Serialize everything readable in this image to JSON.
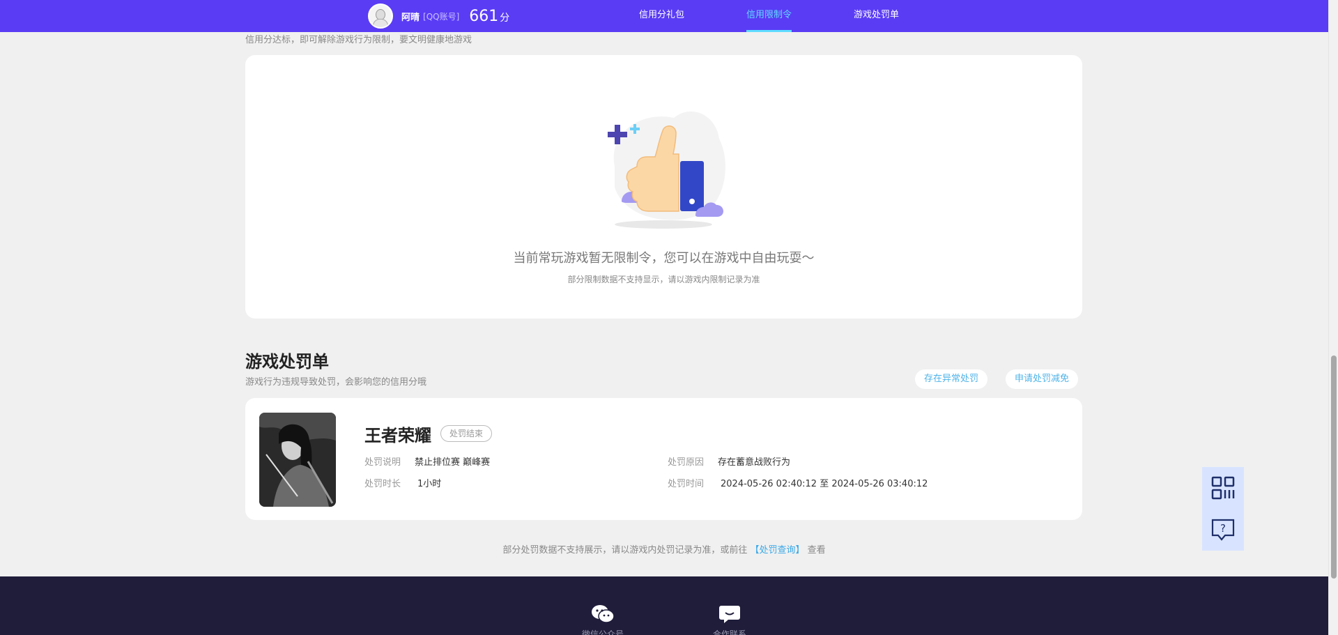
{
  "header": {
    "user_name": "阿晴",
    "account_type": "[QQ账号]",
    "score": "661",
    "score_unit": "分",
    "nav": [
      {
        "label": "信用分礼包",
        "active": false
      },
      {
        "label": "信用限制令",
        "active": true
      },
      {
        "label": "游戏处罚单",
        "active": false
      }
    ]
  },
  "restriction": {
    "tip": "信用分达标，即可解除游戏行为限制，要文明健康地游戏",
    "empty_message": "当前常玩游戏暂无限制令，您可以在游戏中自由玩耍～",
    "empty_sub": "部分限制数据不支持显示，请以游戏内限制记录为准"
  },
  "penalty": {
    "title": "游戏处罚单",
    "subtitle": "游戏行为违规导致处罚，会影响您的信用分哦",
    "btn_abnormal": "存在异常处罚",
    "btn_reduce": "申请处罚减免",
    "item": {
      "game": "王者荣耀",
      "status": "处罚结束",
      "desc_label": "处罚说明",
      "desc_value": "禁止排位赛 巅峰赛",
      "duration_label": "处罚时长",
      "duration_value": "1小时",
      "reason_label": "处罚原因",
      "reason_value": "存在蓄意战败行为",
      "time_label": "处罚时间",
      "time_value": "2024-05-26 02:40:12 至 2024-05-26 03:40:12"
    },
    "bottom_tip_prefix": "部分处罚数据不支持展示，请以游戏内处罚记录为准，或前往",
    "bottom_tip_link": "【处罚查询】",
    "bottom_tip_suffix": "查看"
  },
  "footer": {
    "items": [
      {
        "label": "微信公众号",
        "icon": "wechat-icon"
      },
      {
        "label": "合作联系",
        "icon": "chat-icon"
      }
    ]
  },
  "colors": {
    "topbar": "#5a3cf5",
    "active_nav": "#5fdcff",
    "link": "#38a8e8",
    "footer": "#1f1d3a"
  }
}
